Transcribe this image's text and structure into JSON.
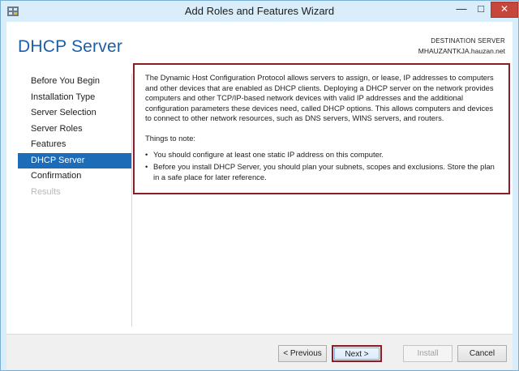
{
  "window": {
    "title": "Add Roles and Features Wizard",
    "minimize_glyph": "—",
    "maximize_glyph": "□",
    "close_glyph": "✕"
  },
  "header": {
    "page_title": "DHCP Server",
    "destination_label": "DESTINATION SERVER",
    "destination_server": "MHAUZANTKJA.hauzan.net"
  },
  "nav": {
    "items": [
      {
        "label": "Before You Begin",
        "state": "normal"
      },
      {
        "label": "Installation Type",
        "state": "normal"
      },
      {
        "label": "Server Selection",
        "state": "normal"
      },
      {
        "label": "Server Roles",
        "state": "normal"
      },
      {
        "label": "Features",
        "state": "normal"
      },
      {
        "label": "DHCP Server",
        "state": "active"
      },
      {
        "label": "Confirmation",
        "state": "normal"
      },
      {
        "label": "Results",
        "state": "disabled"
      }
    ]
  },
  "content": {
    "description": "The Dynamic Host Configuration Protocol allows servers to assign, or lease, IP addresses to computers and other devices that are enabled as DHCP clients. Deploying a DHCP server on the network provides computers and other TCP/IP-based network devices with valid IP addresses and the additional configuration parameters these devices need, called DHCP options. This allows computers and devices to connect to other network resources, such as DNS servers, WINS servers, and routers.",
    "things_heading": "Things to note:",
    "bullets": [
      "You should configure at least one static IP address on this computer.",
      "Before you install DHCP Server, you should plan your subnets, scopes and exclusions. Store the plan in a safe place for later reference."
    ]
  },
  "footer": {
    "previous_label": "< Previous",
    "next_label": "Next >",
    "install_label": "Install",
    "cancel_label": "Cancel"
  },
  "colors": {
    "accent": "#1c6cb8",
    "title_blue": "#1d5fa6",
    "highlight_border": "#8b1f25",
    "close_red": "#c7463b",
    "frame": "#d9edfa"
  }
}
